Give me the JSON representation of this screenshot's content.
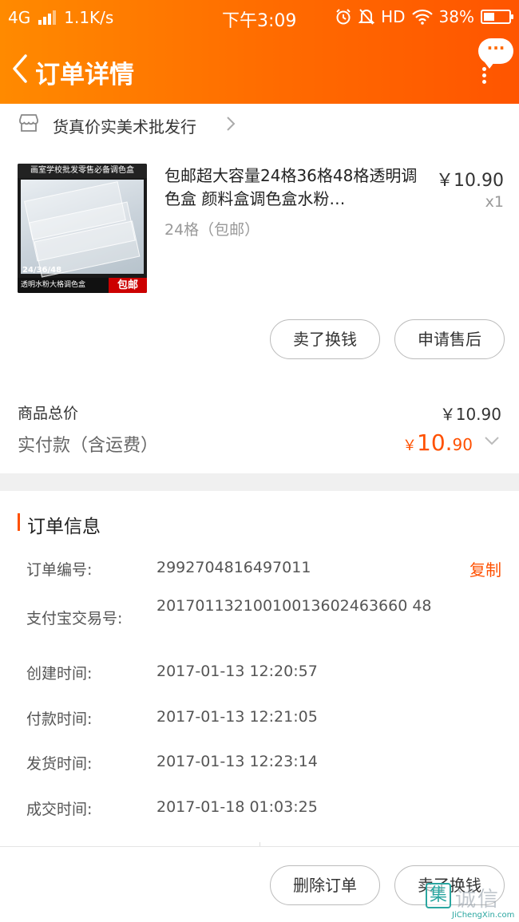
{
  "status_bar": {
    "network": "4G",
    "speed": "1.1K/s",
    "time": "下午3:09",
    "hd": "HD",
    "battery": "38%"
  },
  "nav": {
    "title": "订单详情",
    "chat_dots": "···"
  },
  "shop": {
    "name": "货真价实美术批发行"
  },
  "product": {
    "image_top_text": "画室学校批发零售必备调色盒",
    "image_sizes_text": "24/36/48",
    "image_desc_text": "透明水粉大格调色盒",
    "image_badge_text": "包邮",
    "title": "包邮超大容量24格36格48格透明调色盒 颜料盒调色盒水粉…",
    "spec": "24格（包邮）",
    "price": "￥10.90",
    "quantity": "x1"
  },
  "item_actions": {
    "sell_label": "卖了换钱",
    "after_sale_label": "申请售后"
  },
  "summary": {
    "total_label": "商品总价",
    "total_value": "￥10.90",
    "paid_label": "实付款（含运费）",
    "paid_currency": "￥",
    "paid_integer": "10.",
    "paid_decimal": "90"
  },
  "order_info": {
    "section_title": "订单信息",
    "copy_label": "复制",
    "rows": [
      {
        "label": "订单编号:",
        "value": "2992704816497011"
      },
      {
        "label": "支付宝交易号:",
        "value": "20170113210010013602463660 48"
      },
      {
        "label": "创建时间:",
        "value": "2017-01-13 12:20:57"
      },
      {
        "label": "付款时间:",
        "value": "2017-01-13 12:21:05"
      },
      {
        "label": "发货时间:",
        "value": "2017-01-13 12:23:14"
      },
      {
        "label": "成交时间:",
        "value": "2017-01-18 01:03:25"
      }
    ]
  },
  "bottom_actions": {
    "delete_label": "删除订单",
    "sell_label": "卖了换钱"
  },
  "watermark": {
    "char": "集",
    "text": "诚信",
    "sub": "JiChengXin.com"
  },
  "colors": {
    "brand_orange": "#ff6a00",
    "price_orange": "#ff5000"
  }
}
